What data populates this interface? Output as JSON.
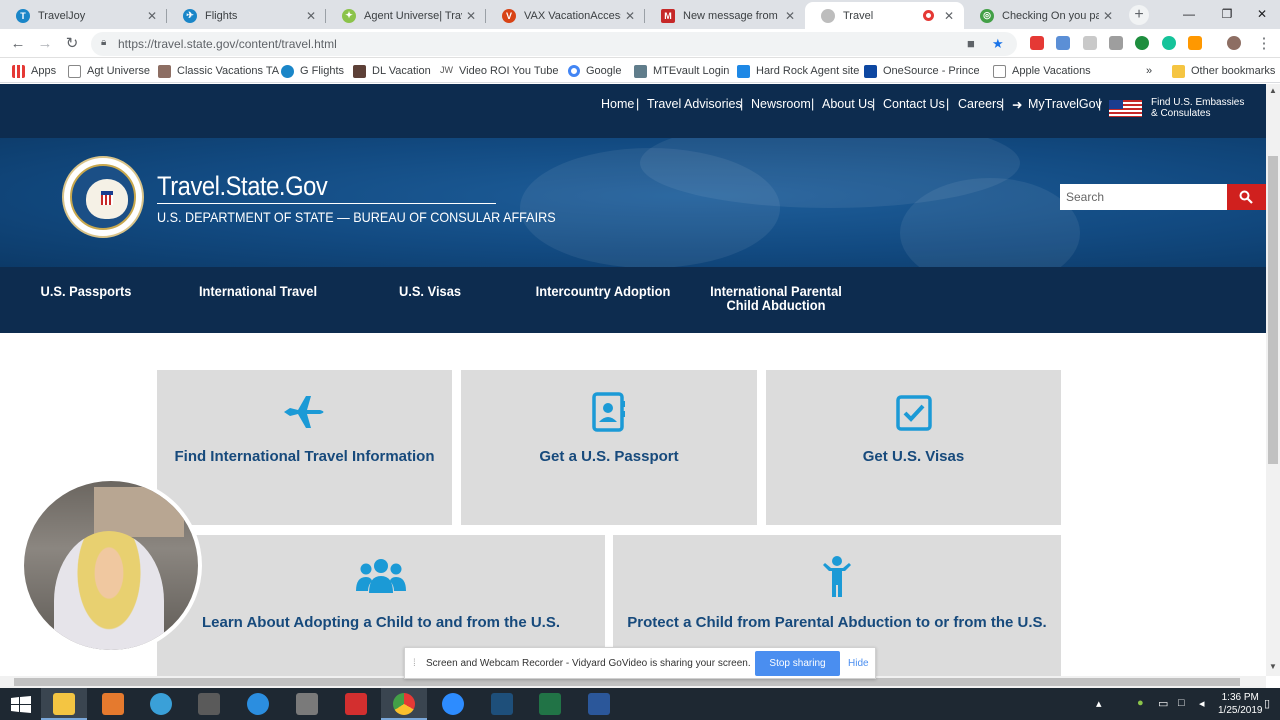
{
  "browser": {
    "tabs": [
      {
        "title": "TravelJoy",
        "color": "#1a86c8"
      },
      {
        "title": "Flights",
        "color": "#1a86c8"
      },
      {
        "title": "Agent Universe| Travel I",
        "color": "#8bc34a"
      },
      {
        "title": "VAX VacationAccess - Fl",
        "color": "#d84315"
      },
      {
        "title": "New message from Kath",
        "color": "#c62828"
      },
      {
        "title": "Travel",
        "color": "#9e9e9e"
      },
      {
        "title": "Checking On you passp",
        "color": "#43a047"
      }
    ],
    "url": "https://travel.state.gov/content/travel.html",
    "bookmarks": [
      {
        "label": "Apps",
        "color": "#e53935"
      },
      {
        "label": "Agt Universe",
        "color": "#ffffff"
      },
      {
        "label": "Classic Vacations TA",
        "color": "#8d6e63"
      },
      {
        "label": "G Flights",
        "color": "#1a86c8"
      },
      {
        "label": "DL Vacation",
        "color": "#5d4037"
      },
      {
        "label": "Video ROI You Tube",
        "color": "#ffffff"
      },
      {
        "label": "Google",
        "color": "#4285f4"
      },
      {
        "label": "MTEvault Login",
        "color": "#607d8b"
      },
      {
        "label": "Hard Rock Agent site",
        "color": "#1e88e5"
      },
      {
        "label": "OneSource - Princess",
        "color": "#0d47a1"
      },
      {
        "label": "Apple Vacations",
        "color": "#ffffff"
      }
    ],
    "bookmarks_more": "»",
    "other_bookmarks": "Other bookmarks"
  },
  "site": {
    "util_links": [
      "Home",
      "Travel Advisories",
      "Newsroom",
      "About Us",
      "Contact Us",
      "Careers",
      "MyTravelGov"
    ],
    "embassy_line1": "Find U.S. Embassies",
    "embassy_line2": "& Consulates",
    "brand": "Travel.State.Gov",
    "brand_sub": "U.S. DEPARTMENT OF STATE — BUREAU OF CONSULAR AFFAIRS",
    "search_placeholder": "Search",
    "nav": [
      {
        "label": "U.S. Passports"
      },
      {
        "label": "International Travel"
      },
      {
        "label": "U.S. Visas"
      },
      {
        "label": "Intercountry Adoption"
      },
      {
        "label": "International Parental Child Abduction"
      }
    ],
    "cards": [
      {
        "label": "Find International Travel Information",
        "icon": "airplane-icon"
      },
      {
        "label": "Get a U.S. Passport",
        "icon": "passport-icon"
      },
      {
        "label": "Get U.S. Visas",
        "icon": "checkbox-icon"
      },
      {
        "label": "Learn About Adopting a Child to and from the U.S.",
        "icon": "group-icon"
      },
      {
        "label": "Protect a Child from Parental Abduction to or from the U.S.",
        "icon": "child-icon"
      }
    ],
    "accent": "#1b9ad6",
    "navy": "#0d2c4f"
  },
  "sharebar": {
    "text": "Screen and Webcam Recorder - Vidyard GoVideo is sharing your screen.",
    "stop": "Stop sharing",
    "hide": "Hide"
  },
  "taskbar": {
    "time": "1:36 PM",
    "date": "1/25/2019"
  }
}
